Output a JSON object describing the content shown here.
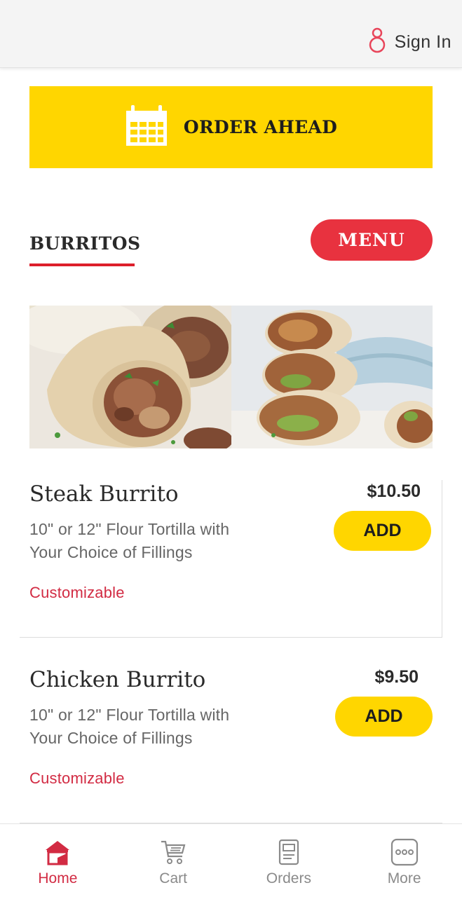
{
  "header": {
    "signin_label": "Sign In",
    "signin_icon": "user-icon"
  },
  "order_ahead": {
    "label": "ORDER AHEAD",
    "icon": "calendar-icon"
  },
  "section": {
    "title": "BURRITOS",
    "menu_button": "MENU"
  },
  "items": [
    {
      "name": "Steak Burrito",
      "description": "10\" or 12\" Flour Tortilla with Your Choice of Fillings",
      "tag": "Customizable",
      "price": "$10.50",
      "add_label": "ADD"
    },
    {
      "name": "Chicken Burrito",
      "description": "10\" or 12\" Flour Tortilla with Your Choice of Fillings",
      "tag": "Customizable",
      "price": "$9.50",
      "add_label": "ADD"
    }
  ],
  "tabs": [
    {
      "label": "Home",
      "icon": "home-icon",
      "active": true
    },
    {
      "label": "Cart",
      "icon": "cart-icon",
      "active": false
    },
    {
      "label": "Orders",
      "icon": "receipt-icon",
      "active": false
    },
    {
      "label": "More",
      "icon": "more-icon",
      "active": false
    }
  ],
  "colors": {
    "accent_yellow": "#ffd600",
    "accent_red": "#e8323f",
    "active_tab": "#d22b43"
  }
}
